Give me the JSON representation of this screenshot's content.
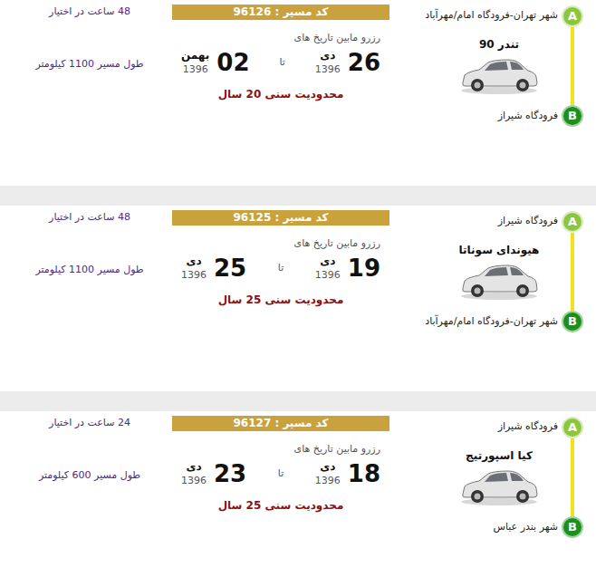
{
  "routes": [
    {
      "marker_a": "A",
      "marker_b": "B",
      "from": "شهر تهران-فرودگاه امام/مهرآباد",
      "to": "فرودگاه شیراز",
      "car": "تندر 90",
      "code": "کد مسیر : 96126",
      "reserve_label": "رزرو مابین تاریخ های",
      "start_day": "26",
      "start_month": "دی",
      "start_year": "1396",
      "until": "تا",
      "end_day": "02",
      "end_month": "بهمن",
      "end_year": "1396",
      "age_limit": "محدودیت سنی 20 سال",
      "hours": "48 ساعت در اختیار",
      "distance": "طول مسیر 1100 کیلومتر"
    },
    {
      "marker_a": "A",
      "marker_b": "B",
      "from": "فرودگاه شیراز",
      "to": "شهر تهران-فرودگاه امام/مهرآباد",
      "car": "هیوندای سوناتا",
      "code": "کد مسیر : 96125",
      "reserve_label": "رزرو مابین تاریخ های",
      "start_day": "19",
      "start_month": "دی",
      "start_year": "1396",
      "until": "تا",
      "end_day": "25",
      "end_month": "دی",
      "end_year": "1396",
      "age_limit": "محدودیت سنی 25 سال",
      "hours": "48 ساعت در اختیار",
      "distance": "طول مسیر 1100 کیلومتر"
    },
    {
      "marker_a": "A",
      "marker_b": "B",
      "from": "فرودگاه شیراز",
      "to": "شهر بندر عباس",
      "car": "کیا اسپورتیج",
      "code": "کد مسیر : 96127",
      "reserve_label": "رزرو مابین تاریخ های",
      "start_day": "18",
      "start_month": "دی",
      "start_year": "1396",
      "until": "تا",
      "end_day": "23",
      "end_month": "دی",
      "end_year": "1396",
      "age_limit": "محدودیت سنی 25 سال",
      "hours": "24 ساعت در اختیار",
      "distance": "طول مسیر 600 کیلومتر"
    }
  ]
}
